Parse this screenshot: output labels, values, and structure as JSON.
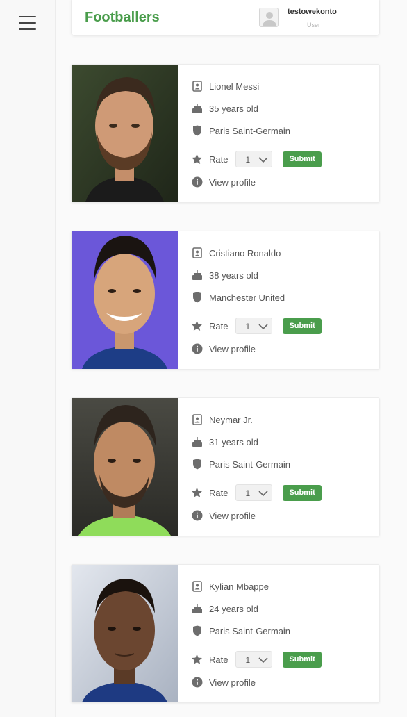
{
  "header": {
    "title": "Footballers",
    "user_name": "testowekonto",
    "user_role": "User"
  },
  "rate_label": "Rate",
  "submit_label": "Submit",
  "view_profile_label": "View profile",
  "colors": {
    "brand": "#4a9d4c",
    "text": "#555555"
  },
  "players": [
    {
      "name": "Lionel Messi",
      "age": "35 years old",
      "club": "Paris Saint-Germain",
      "rating": "1",
      "photo_bg": "#2f3a28"
    },
    {
      "name": "Cristiano Ronaldo",
      "age": "38 years old",
      "club": "Manchester United",
      "rating": "1",
      "photo_bg": "#6b57d9"
    },
    {
      "name": "Neymar Jr.",
      "age": "31 years old",
      "club": "Paris Saint-Germain",
      "rating": "1",
      "photo_bg": "#3a3a34"
    },
    {
      "name": "Kylian Mbappe",
      "age": "24 years old",
      "club": "Paris Saint-Germain",
      "rating": "1",
      "photo_bg": "#c9cfd8"
    }
  ]
}
